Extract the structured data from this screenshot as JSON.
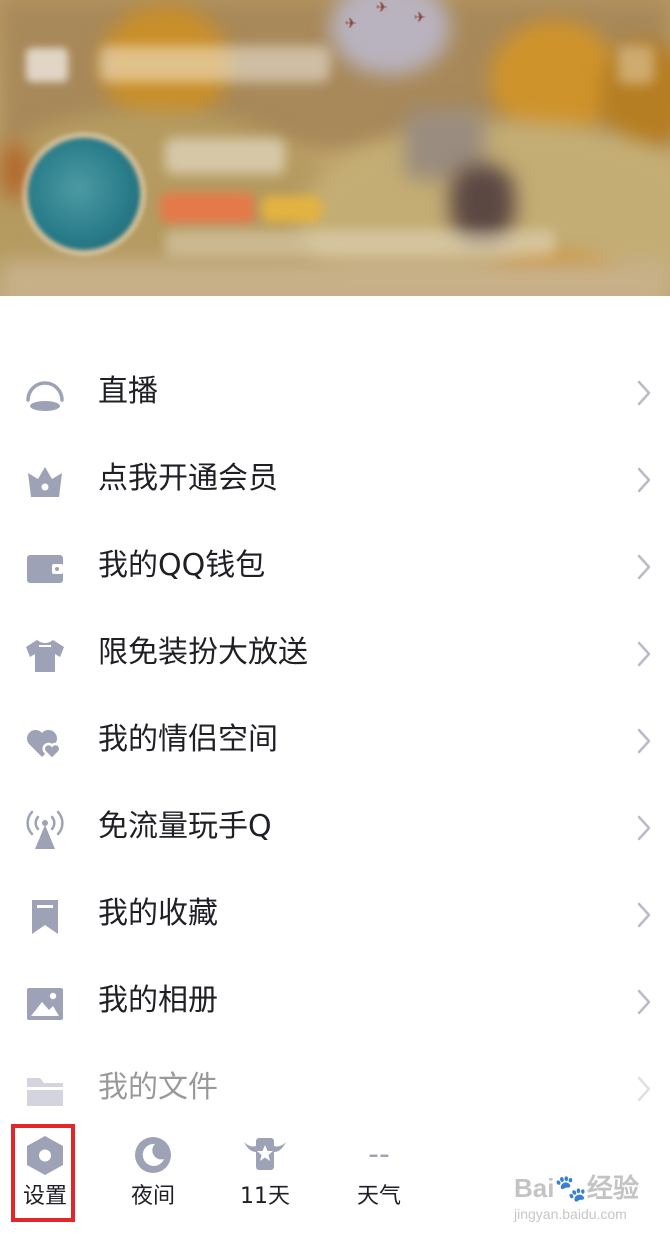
{
  "menu": {
    "items": [
      {
        "label": "直播",
        "icon": "live-icon"
      },
      {
        "label": "点我开通会员",
        "icon": "crown-icon"
      },
      {
        "label": "我的QQ钱包",
        "icon": "wallet-icon"
      },
      {
        "label": "限免装扮大放送",
        "icon": "tshirt-icon"
      },
      {
        "label": "我的情侣空间",
        "icon": "couple-hearts-icon"
      },
      {
        "label": "免流量玩手Q",
        "icon": "signal-tower-icon"
      },
      {
        "label": "我的收藏",
        "icon": "bookmark-icon"
      },
      {
        "label": "我的相册",
        "icon": "photo-album-icon"
      },
      {
        "label": "我的文件",
        "icon": "folder-icon"
      }
    ]
  },
  "toolbar": {
    "settings_label": "设置",
    "night_label": "夜间",
    "days_label": "11天",
    "weather_value": "--",
    "weather_label": "天气"
  },
  "watermark": {
    "text_a": "Bai",
    "text_b": "经验",
    "url": "jingyan.baidu.com"
  },
  "colors": {
    "icon_gray": "#9ea2b6",
    "text": "#1f1f26",
    "chevron": "#b9bcc8",
    "highlight": "#e4252a"
  }
}
